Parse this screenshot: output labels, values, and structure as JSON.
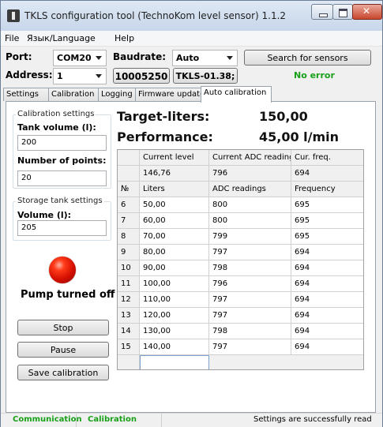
{
  "window": {
    "title": "TKLS configuration tool (TechnoKom level sensor) 1.1.2"
  },
  "menu": [
    "File",
    "Язык/Language",
    "Help"
  ],
  "connection": {
    "port_label": "Port:",
    "port_value": "COM20",
    "baud_label": "Baudrate:",
    "baud_value": "Auto",
    "address_label": "Address:",
    "address_value": "1",
    "serial": "10005250",
    "model": "TKLS-01.38;",
    "search_button": "Search for sensors",
    "status": "No error"
  },
  "tabs": [
    "Settings",
    "Calibration",
    "Logging",
    "Firmware update",
    "Auto calibration"
  ],
  "calibration_settings": {
    "group_title": "Calibration settings",
    "tank_volume_label": "Tank volume (l):",
    "tank_volume_value": "200",
    "points_label": "Number of points:",
    "points_value": "20"
  },
  "storage_settings": {
    "group_title": "Storage tank settings",
    "volume_label": "Volume (l):",
    "volume_value": "205"
  },
  "pump": {
    "indicator_color": "#e01a00",
    "status": "Pump turned off"
  },
  "buttons": {
    "stop": "Stop",
    "pause": "Pause",
    "save": "Save calibration"
  },
  "targets": {
    "target_label": "Target-liters:",
    "target_value": "150,00",
    "perf_label": "Performance:",
    "perf_value": "45,00 l/min"
  },
  "current": {
    "headers": [
      "Current level",
      "Current ADC readings",
      "Cur. freq."
    ],
    "values": [
      "146,76",
      "796",
      "694"
    ]
  },
  "table": {
    "headers": [
      "№",
      "Liters",
      "ADC readings",
      "Frequency"
    ],
    "rows": [
      [
        "6",
        "50,00",
        "800",
        "695"
      ],
      [
        "7",
        "60,00",
        "800",
        "695"
      ],
      [
        "8",
        "70,00",
        "799",
        "695"
      ],
      [
        "9",
        "80,00",
        "797",
        "694"
      ],
      [
        "10",
        "90,00",
        "798",
        "694"
      ],
      [
        "11",
        "100,00",
        "796",
        "694"
      ],
      [
        "12",
        "110,00",
        "797",
        "694"
      ],
      [
        "13",
        "120,00",
        "797",
        "694"
      ],
      [
        "14",
        "130,00",
        "798",
        "694"
      ],
      [
        "15",
        "140,00",
        "797",
        "694"
      ]
    ]
  },
  "statusbar": {
    "communication": "Communication",
    "calibration": "Calibration",
    "message": "Settings are successfully read"
  }
}
